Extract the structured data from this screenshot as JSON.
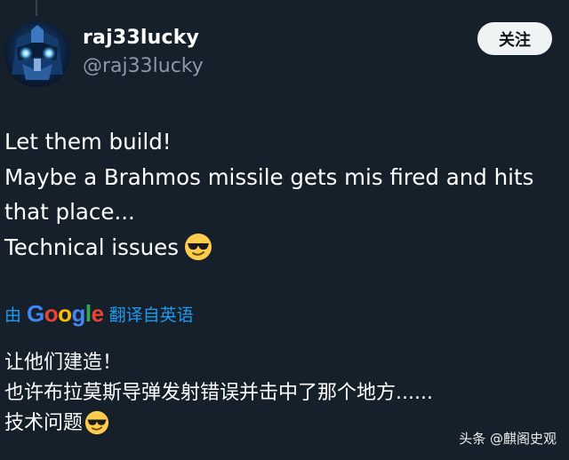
{
  "user": {
    "display_name": "raj33lucky",
    "handle": "@raj33lucky"
  },
  "follow_button": {
    "label": "关注"
  },
  "tweet": {
    "lines": [
      "Let them build!",
      "Maybe a Brahmos missile gets mis fired and hits",
      "that place...",
      "Technical issues"
    ],
    "emoji": "smiling-face-with-sunglasses"
  },
  "translation": {
    "prefix": "由",
    "provider": "Google",
    "suffix": "翻译自英语",
    "lines": [
      "让他们建造！",
      "也许布拉莫斯导弹发射错误并击中了那个地方......",
      "技术问题"
    ]
  },
  "watermark": "头条 @麒阁史观",
  "colors": {
    "background": "#15202b",
    "link": "#1d9bf0",
    "secondary_text": "#8b98a5",
    "button_bg": "#eff3f4"
  }
}
